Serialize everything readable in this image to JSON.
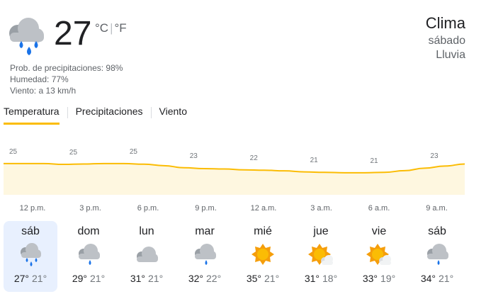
{
  "current": {
    "icon": "rain-cloud-icon",
    "temperature": "27",
    "unit_c": "°C",
    "unit_sep": "|",
    "unit_f": "°F",
    "precip": "Prob. de precipitaciones: 98%",
    "humidity": "Humedad: 77%",
    "wind": "Viento: a 13 km/h"
  },
  "header": {
    "title": "Clima",
    "day": "sábado",
    "condition": "Lluvia"
  },
  "tabs": [
    "Temperatura",
    "Precipitaciones",
    "Viento"
  ],
  "colors": {
    "accent": "#fbbc04",
    "chart_fill": "#fef7e0",
    "rain_drop": "#1a73e8",
    "sun": "#f59e0b",
    "cloud": "#9aa0a6"
  },
  "chart_data": {
    "type": "area",
    "x": [
      "12 p.m.",
      "1 p.m.",
      "2 p.m.",
      "3 p.m.",
      "4 p.m.",
      "5 p.m.",
      "6 p.m.",
      "7 p.m.",
      "8 p.m.",
      "9 p.m.",
      "10 p.m.",
      "11 p.m.",
      "12 a.m.",
      "1 a.m.",
      "2 a.m.",
      "3 a.m.",
      "4 a.m.",
      "5 a.m.",
      "6 a.m.",
      "7 a.m.",
      "8 a.m.",
      "9 a.m.",
      "10 a.m.",
      "11 a.m."
    ],
    "values": [
      25,
      25,
      25,
      24.6,
      24.8,
      25,
      25,
      24.7,
      24,
      23,
      22.6,
      22.4,
      22,
      21.8,
      21.5,
      21,
      20.8,
      20.6,
      20.6,
      20.8,
      21.6,
      22.8,
      23.8,
      24.8
    ],
    "point_labels": [
      {
        "index": 0,
        "text": "25"
      },
      {
        "index": 3,
        "text": "25"
      },
      {
        "index": 6,
        "text": "25"
      },
      {
        "index": 9,
        "text": "23"
      },
      {
        "index": 12,
        "text": "22"
      },
      {
        "index": 15,
        "text": "21"
      },
      {
        "index": 18,
        "text": "21"
      },
      {
        "index": 21,
        "text": "23"
      }
    ],
    "tick_labels": [
      "12 p.m.",
      "3 p.m.",
      "6 p.m.",
      "9 p.m.",
      "12 a.m.",
      "3 a.m.",
      "6 a.m.",
      "9 a.m."
    ],
    "ylim": [
      10,
      27
    ],
    "grid": false
  },
  "forecast": [
    {
      "day": "sáb",
      "icon": "rain-cloud-icon",
      "high": "27°",
      "low": "21°",
      "selected": true
    },
    {
      "day": "dom",
      "icon": "cloud-drizzle-icon",
      "high": "29°",
      "low": "21°"
    },
    {
      "day": "lun",
      "icon": "cloud-icon",
      "high": "31°",
      "low": "21°"
    },
    {
      "day": "mar",
      "icon": "cloud-drizzle-icon",
      "high": "32°",
      "low": "22°"
    },
    {
      "day": "mié",
      "icon": "sun-icon",
      "high": "35°",
      "low": "21°"
    },
    {
      "day": "jue",
      "icon": "partly-cloudy-icon",
      "high": "31°",
      "low": "18°"
    },
    {
      "day": "vie",
      "icon": "partly-cloudy-icon",
      "high": "33°",
      "low": "19°"
    },
    {
      "day": "sáb",
      "icon": "cloud-drizzle-icon",
      "high": "34°",
      "low": "21°"
    }
  ]
}
